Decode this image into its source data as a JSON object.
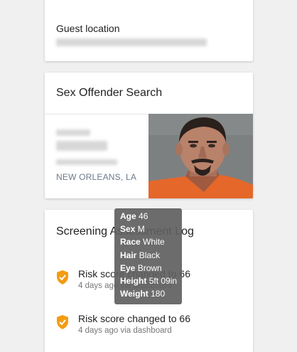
{
  "guest_card": {
    "label": "Guest location"
  },
  "offender_card": {
    "title": "Sex Offender Search",
    "city": "NEW ORLEANS, LA",
    "photo": "mugshot-photo"
  },
  "log_card": {
    "title": "Screening Assessment Log",
    "items": [
      {
        "text": "Risk score changed to 66",
        "meta": "4 days ago via dashboard"
      },
      {
        "text": "Risk score changed to 66",
        "meta": "4 days ago via dashboard"
      }
    ]
  },
  "tooltip": {
    "rows": [
      {
        "key": "Age",
        "value": "46"
      },
      {
        "key": "Sex",
        "value": "M"
      },
      {
        "key": "Race",
        "value": "White"
      },
      {
        "key": "Hair",
        "value": "Black"
      },
      {
        "key": "Eye",
        "value": "Brown"
      },
      {
        "key": "Height",
        "value": "5ft 09in"
      },
      {
        "key": "Weight",
        "value": "180"
      }
    ]
  },
  "colors": {
    "shield": "#f39c12",
    "city_text": "#6a7a8c",
    "tooltip_bg": "#606060"
  },
  "icons": {
    "log_item": "shield-check-icon"
  }
}
